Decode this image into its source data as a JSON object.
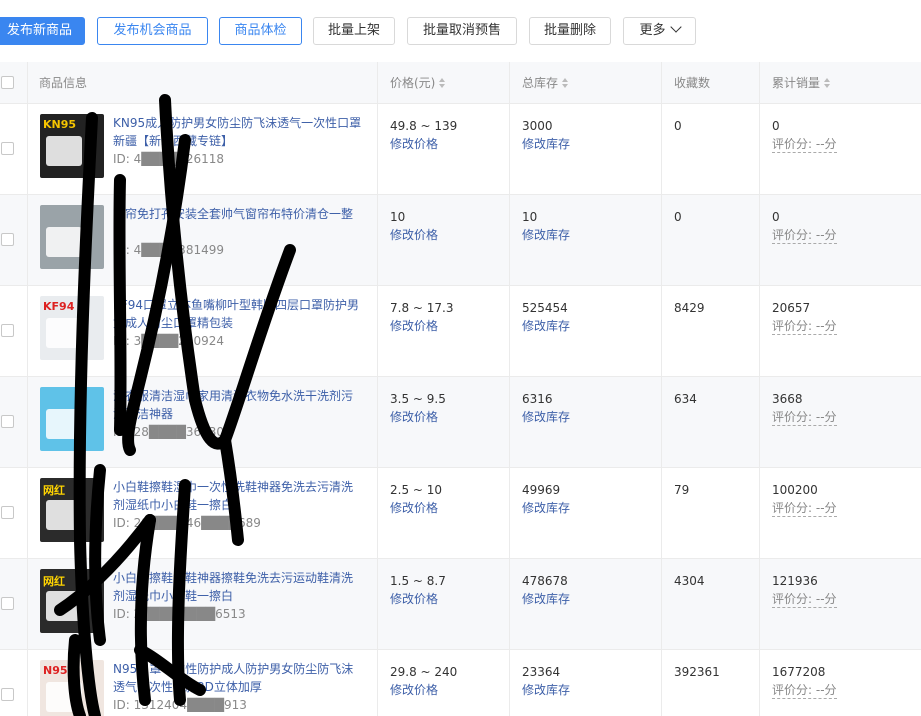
{
  "toolbar": {
    "publish_new": "发布新商品",
    "publish_opportunity": "发布机会商品",
    "product_check": "商品体检",
    "batch_list": "批量上架",
    "batch_cancel_presale": "批量取消预售",
    "batch_delete": "批量删除",
    "more": "更多"
  },
  "table": {
    "headers": {
      "product_info": "商品信息",
      "price": "价格(元)",
      "stock": "总库存",
      "favorites": "收藏数",
      "sales": "累计销量"
    },
    "edit_price": "修改价格",
    "edit_stock": "修改库存",
    "rows": [
      {
        "title": "KN95成人防护男女防尘防飞沫透气一次性口罩新疆【新疆西藏专链】",
        "id": "ID: 4████526118",
        "price": "49.8 ~ 139",
        "stock": "3000",
        "favorites": "0",
        "sales": "0",
        "rating": "评价分: --分"
      },
      {
        "title": "窗帘免打孔安装全套帅气窗帘布特价清仓一整套",
        "id": "ID: 4████381499",
        "price": "10",
        "stock": "10",
        "favorites": "0",
        "sales": "0",
        "rating": "评价分: --分"
      },
      {
        "title": "KF94口罩立体鱼嘴柳叶型韩版四层口罩防护男女成人防尘口罩精包装",
        "id": "ID: 3████200924",
        "price": "7.8 ~ 17.3",
        "stock": "525454",
        "favorites": "8429",
        "sales": "20657",
        "rating": "评价分: --分"
      },
      {
        "title": "洗衣服清洁湿巾家用清洗衣物免水洗干洗剂污渍清洁神器",
        "id": "ID: 28████367305",
        "price": "3.5 ~ 9.5",
        "stock": "6316",
        "favorites": "634",
        "sales": "3668",
        "rating": "评价分: --分"
      },
      {
        "title": "小白鞋擦鞋湿巾一次性洗鞋神器免洗去污清洗剂湿纸巾小白鞋一擦白",
        "id": "ID: 28████46████689",
        "price": "2.5 ~ 10",
        "stock": "49969",
        "favorites": "79",
        "sales": "100200",
        "rating": "评价分: --分"
      },
      {
        "title": "小白鞋擦鞋洗鞋神器擦鞋免洗去污运动鞋清洗剂湿纸巾小白鞋一擦白",
        "id": "ID: 2████████6513",
        "price": "1.5 ~ 8.7",
        "stock": "478678",
        "favorites": "4304",
        "sales": "121936",
        "rating": "评价分: --分"
      },
      {
        "title": "N95口罩一次性防护成人防护男女防尘防飞沫透气一次性新款3D立体加厚",
        "id": "ID: 1312404████913",
        "price": "29.8 ~ 240",
        "stock": "23364",
        "favorites": "392361",
        "sales": "1677208",
        "rating": "评价分: --分"
      }
    ]
  },
  "thumb_labels": [
    "KN95",
    "",
    "KF94",
    "",
    "网红",
    "网红",
    "N95"
  ],
  "colors": {
    "primary": "#3a86f0",
    "link": "#3d5fa8",
    "alt_row": "#f7f8fa",
    "border": "#ebebeb"
  }
}
